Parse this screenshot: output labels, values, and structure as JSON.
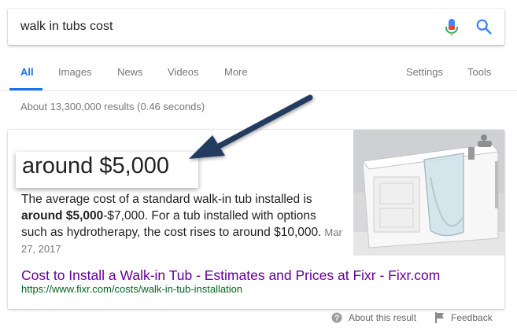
{
  "search": {
    "query": "walk in tubs cost"
  },
  "tabs": [
    {
      "label": "All",
      "active": true
    },
    {
      "label": "Images"
    },
    {
      "label": "News"
    },
    {
      "label": "Videos"
    },
    {
      "label": "More"
    }
  ],
  "tools": {
    "settings": "Settings",
    "tools": "Tools"
  },
  "result_stats": "About 13,300,000 results (0.46 seconds)",
  "featured": {
    "answer": "around $5,000",
    "snippet_pre": "The average cost of a standard walk-in tub installed is ",
    "snippet_bold": "around $5,000",
    "snippet_post": "-$7,000. For a tub installed with options such as hydrotherapy, the cost rises to around $10,000.",
    "date": "Mar 27, 2017",
    "title": "Cost to Install a Walk-in Tub - Estimates and Prices at Fixr - Fixr.com",
    "url": "https://www.fixr.com/costs/walk-in-tub-installation"
  },
  "footer": {
    "about": "About this result",
    "feedback": "Feedback"
  },
  "colors": {
    "accent": "#1a73e8",
    "visited_link": "#660099",
    "url_green": "#006621",
    "arrow": "#243a5e"
  },
  "icons": {
    "mic": "microphone-icon",
    "search": "magnifier-icon",
    "help": "question-circle-icon",
    "feedback": "flag-icon",
    "image": "walk-in-tub-photo"
  }
}
